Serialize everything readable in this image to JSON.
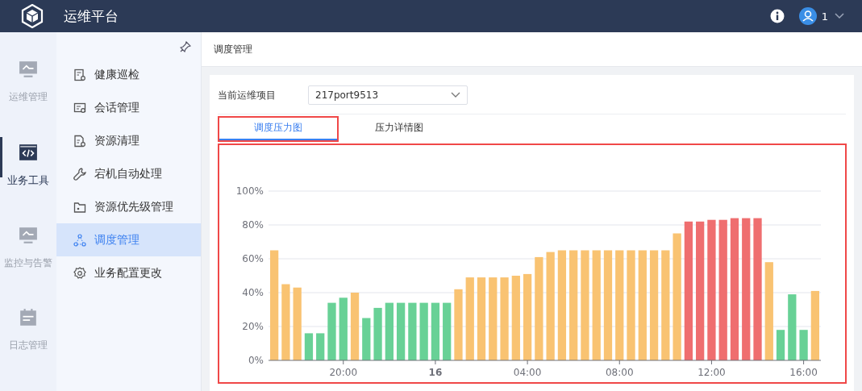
{
  "header": {
    "title": "运维平台",
    "user": "1"
  },
  "rail": [
    {
      "label": "运维管理",
      "kind": "monitor",
      "selected": false
    },
    {
      "label": "业务工具",
      "kind": "code",
      "selected": true
    },
    {
      "label": "监控与告警",
      "kind": "monitor",
      "selected": false
    },
    {
      "label": "日志管理",
      "kind": "calendar",
      "selected": false
    }
  ],
  "submenu": [
    {
      "label": "健康巡检",
      "kind": "doc",
      "selected": false
    },
    {
      "label": "会话管理",
      "kind": "session",
      "selected": false
    },
    {
      "label": "资源清理",
      "kind": "file",
      "selected": false
    },
    {
      "label": "宕机自动处理",
      "kind": "wrench",
      "selected": false
    },
    {
      "label": "资源优先级管理",
      "kind": "folder",
      "selected": false
    },
    {
      "label": "调度管理",
      "kind": "nodes",
      "selected": true
    },
    {
      "label": "业务配置更改",
      "kind": "gear",
      "selected": false
    }
  ],
  "page": {
    "title": "调度管理",
    "project_label": "当前运维项目",
    "project": "217port9513",
    "tabs": [
      {
        "label": "调度压力图",
        "selected": true,
        "highlighted": true
      },
      {
        "label": "压力详情图",
        "selected": false,
        "highlighted": false
      }
    ],
    "chart_highlighted": true,
    "chart_data": {
      "type": "bar",
      "ylim": [
        0,
        100
      ],
      "grid": true,
      "categories": [
        null,
        null,
        null,
        null,
        null,
        null,
        "20:00",
        null,
        null,
        null,
        null,
        null,
        null,
        null,
        "16",
        null,
        null,
        null,
        null,
        null,
        null,
        null,
        "04:00",
        null,
        null,
        null,
        null,
        null,
        null,
        null,
        "08:00",
        null,
        null,
        null,
        null,
        null,
        null,
        null,
        "12:00",
        null,
        null,
        null,
        null,
        null,
        null,
        null,
        "16:00",
        null
      ],
      "yticks": [
        {
          "value": 0,
          "label": "0%"
        },
        {
          "value": 20,
          "label": "20%"
        },
        {
          "value": 40,
          "label": "40%"
        },
        {
          "value": 60,
          "label": "60%"
        },
        {
          "value": 80,
          "label": "80%"
        },
        {
          "value": 100,
          "label": "100%"
        }
      ],
      "series": [
        {
          "color": "#68d196",
          "values": [
            null,
            null,
            null,
            16,
            16,
            34,
            37,
            null,
            25,
            31,
            34,
            34,
            34,
            34,
            34,
            34,
            null,
            null,
            null,
            null,
            null,
            null,
            null,
            null,
            null,
            null,
            null,
            null,
            null,
            null,
            null,
            null,
            null,
            null,
            null,
            null,
            null,
            null,
            null,
            null,
            null,
            null,
            null,
            null,
            18,
            39,
            18,
            null
          ]
        },
        {
          "color": "#f9c372",
          "values": [
            65,
            45,
            43,
            null,
            null,
            null,
            null,
            40,
            null,
            null,
            null,
            null,
            null,
            null,
            null,
            null,
            42,
            49,
            49,
            49,
            49,
            50,
            51,
            61,
            64,
            65,
            65,
            65,
            65,
            65,
            65,
            65,
            65,
            65,
            65,
            75,
            null,
            null,
            null,
            null,
            null,
            null,
            null,
            58,
            null,
            null,
            null,
            41
          ]
        },
        {
          "color": "#ef6e6f",
          "values": [
            null,
            null,
            null,
            null,
            null,
            null,
            null,
            null,
            null,
            null,
            null,
            null,
            null,
            null,
            null,
            null,
            null,
            null,
            null,
            null,
            null,
            null,
            null,
            null,
            null,
            null,
            null,
            null,
            null,
            null,
            null,
            null,
            null,
            null,
            null,
            null,
            82,
            82,
            83,
            83,
            84,
            84,
            84,
            null,
            null,
            null,
            null,
            null
          ]
        }
      ]
    }
  }
}
